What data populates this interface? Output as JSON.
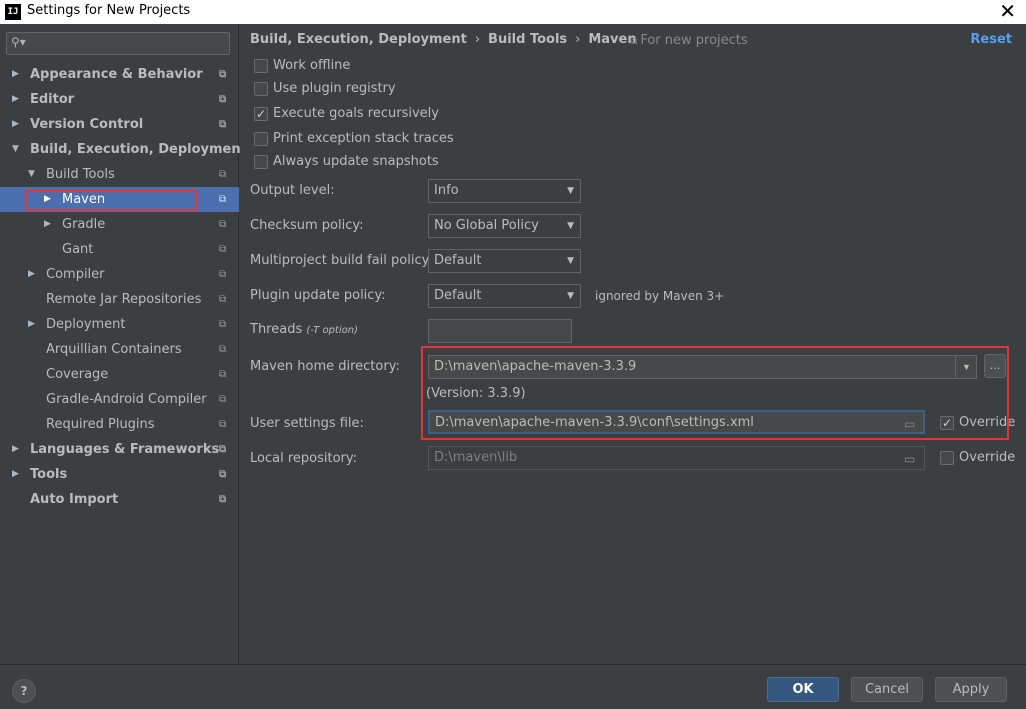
{
  "window": {
    "title": "Settings for New Projects",
    "app_icon_text": "IJ"
  },
  "sidebar": {
    "search_placeholder": "",
    "items": [
      {
        "label": "Appearance & Behavior"
      },
      {
        "label": "Editor"
      },
      {
        "label": "Version Control"
      },
      {
        "label": "Build, Execution, Deployment"
      },
      {
        "label": "Build Tools"
      },
      {
        "label": "Maven"
      },
      {
        "label": "Gradle"
      },
      {
        "label": "Gant"
      },
      {
        "label": "Compiler"
      },
      {
        "label": "Remote Jar Repositories"
      },
      {
        "label": "Deployment"
      },
      {
        "label": "Arquillian Containers"
      },
      {
        "label": "Coverage"
      },
      {
        "label": "Gradle-Android Compiler"
      },
      {
        "label": "Required Plugins"
      },
      {
        "label": "Languages & Frameworks"
      },
      {
        "label": "Tools"
      },
      {
        "label": "Auto Import"
      }
    ]
  },
  "header": {
    "crumb1": "Build, Execution, Deployment",
    "crumb2": "Build Tools",
    "crumb3": "Maven",
    "separator": "›",
    "for_new_projects": "For new projects",
    "reset": "Reset"
  },
  "options": {
    "work_offline": {
      "label": "Work offline",
      "checked": false
    },
    "use_plugin_registry": {
      "label": "Use plugin registry",
      "checked": false
    },
    "execute_goals_recursively": {
      "label": "Execute goals recursively",
      "checked": true
    },
    "print_exception": {
      "label": "Print exception stack traces",
      "checked": false
    },
    "always_update_snapshots": {
      "label": "Always update snapshots",
      "checked": false
    }
  },
  "fields": {
    "output_level": {
      "label": "Output level:",
      "value": "Info"
    },
    "checksum_policy": {
      "label": "Checksum policy:",
      "value": "No Global Policy"
    },
    "multiproject_fail_policy": {
      "label": "Multiproject build fail policy:",
      "value": "Default"
    },
    "plugin_update_policy": {
      "label": "Plugin update policy:",
      "value": "Default",
      "note": "ignored by Maven 3+"
    },
    "threads": {
      "label": "Threads",
      "hint": "(-T option)",
      "value": ""
    },
    "maven_home": {
      "label": "Maven home directory:",
      "value": "D:\\maven\\apache-maven-3.3.9",
      "version": "(Version: 3.3.9)",
      "browse": "..."
    },
    "user_settings": {
      "label": "User settings file:",
      "value": "D:\\maven\\apache-maven-3.3.9\\conf\\settings.xml",
      "override_label": "Override",
      "override_checked": true
    },
    "local_repository": {
      "label": "Local repository:",
      "value": "D:\\maven\\lib",
      "override_label": "Override",
      "override_checked": false
    }
  },
  "footer": {
    "help": "?",
    "ok": "OK",
    "cancel": "Cancel",
    "apply": "Apply"
  },
  "colors": {
    "background": "#3c3f41",
    "selection": "#4b6eaf",
    "highlight_box": "#e0353b",
    "link": "#589df6"
  },
  "icons": {
    "search": "search-icon",
    "project": "project-scope-icon",
    "folder": "folder-icon"
  }
}
